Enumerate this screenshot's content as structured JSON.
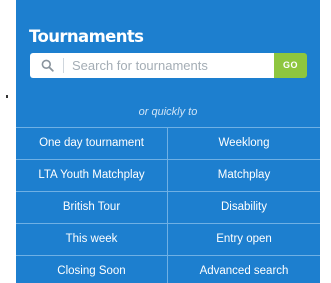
{
  "widget": {
    "title": "Tournaments",
    "search": {
      "placeholder": "Search for tournaments",
      "icon": "search-icon",
      "go_label": "GO"
    },
    "quick_label": "or quickly to",
    "links": [
      [
        "One day tournament",
        "Weeklong"
      ],
      [
        "LTA Youth Matchplay",
        "Matchplay"
      ],
      [
        "British Tour",
        "Disability"
      ],
      [
        "This week",
        "Entry open"
      ],
      [
        "Closing Soon",
        "Advanced search"
      ]
    ]
  },
  "colors": {
    "panel": "#1d7fcf",
    "divider": "#6fb0e4",
    "go_button": "#8ec63f",
    "text": "#ffffff"
  }
}
